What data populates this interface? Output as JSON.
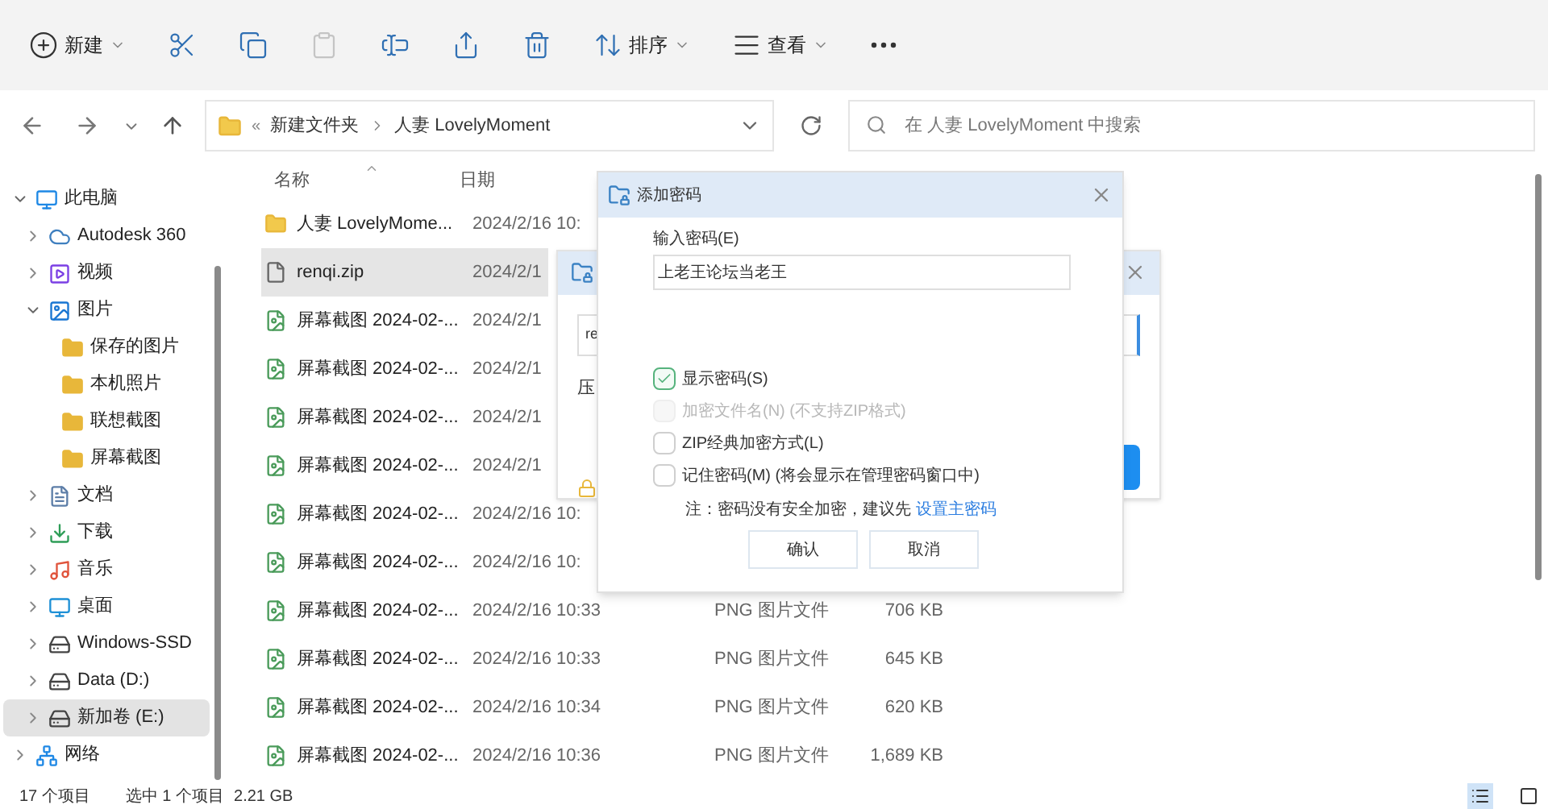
{
  "toolbar": {
    "items": [
      {
        "kind": "new",
        "label": "新建",
        "dropdown": true,
        "disabled": false
      },
      {
        "kind": "cut",
        "dropdown": false,
        "disabled": false
      },
      {
        "kind": "copy",
        "dropdown": false,
        "disabled": false
      },
      {
        "kind": "paste",
        "dropdown": false,
        "disabled": true
      },
      {
        "kind": "rename",
        "dropdown": false,
        "disabled": false
      },
      {
        "kind": "share",
        "dropdown": false,
        "disabled": false
      },
      {
        "kind": "delete",
        "dropdown": false,
        "disabled": false
      },
      {
        "kind": "sort",
        "label": "排序",
        "dropdown": true,
        "disabled": false
      },
      {
        "kind": "view",
        "label": "查看",
        "dropdown": true,
        "disabled": false
      },
      {
        "kind": "more",
        "dropdown": false,
        "disabled": false
      }
    ]
  },
  "address": {
    "overflow": "«",
    "segments": [
      "新建文件夹",
      "人妻 LovelyMoment"
    ]
  },
  "search": {
    "placeholder": "在 人妻 LovelyMoment 中搜索"
  },
  "sidebar": {
    "items": [
      {
        "kind": "pc",
        "label": "此电脑",
        "expanded": true,
        "selected": false,
        "children": [
          {
            "kind": "cloud",
            "label": "Autodesk 360",
            "expanded": false,
            "selected": false
          },
          {
            "kind": "video",
            "label": "视频",
            "expanded": false,
            "selected": false
          },
          {
            "kind": "picture",
            "label": "图片",
            "expanded": true,
            "selected": false,
            "children": [
              {
                "kind": "folder",
                "label": "保存的图片",
                "selected": false
              },
              {
                "kind": "folder",
                "label": "本机照片",
                "selected": false
              },
              {
                "kind": "folder",
                "label": "联想截图",
                "selected": false
              },
              {
                "kind": "folder",
                "label": "屏幕截图",
                "selected": false
              }
            ]
          },
          {
            "kind": "doc",
            "label": "文档",
            "expanded": false,
            "selected": false
          },
          {
            "kind": "download",
            "label": "下载",
            "expanded": false,
            "selected": false
          },
          {
            "kind": "music",
            "label": "音乐",
            "expanded": false,
            "selected": false
          },
          {
            "kind": "desktop",
            "label": "桌面",
            "expanded": false,
            "selected": false
          },
          {
            "kind": "drive",
            "label": "Windows-SSD",
            "expanded": false,
            "selected": false
          },
          {
            "kind": "drive",
            "label": "Data (D:)",
            "expanded": false,
            "selected": false
          },
          {
            "kind": "drive",
            "label": "新加卷 (E:)",
            "expanded": false,
            "selected": true
          }
        ]
      },
      {
        "kind": "network",
        "label": "网络",
        "expanded": false,
        "selected": false
      }
    ]
  },
  "file_list": {
    "columns": [
      "名称",
      "日期"
    ],
    "rows": [
      {
        "kind": "folder",
        "name": "人妻 LovelyMome...",
        "date": "2024/2/16 10:",
        "selected": false
      },
      {
        "kind": "file",
        "name": "renqi.zip",
        "date": "2024/2/1",
        "selected": true
      },
      {
        "kind": "image",
        "name": "屏幕截图 2024-02-...",
        "date": "2024/2/1",
        "selected": false
      },
      {
        "kind": "image",
        "name": "屏幕截图 2024-02-...",
        "date": "2024/2/1",
        "selected": false
      },
      {
        "kind": "image",
        "name": "屏幕截图 2024-02-...",
        "date": "2024/2/1",
        "selected": false
      },
      {
        "kind": "image",
        "name": "屏幕截图 2024-02-...",
        "date": "2024/2/1",
        "selected": false
      },
      {
        "kind": "image",
        "name": "屏幕截图 2024-02-...",
        "date": "2024/2/16 10:",
        "selected": false
      },
      {
        "kind": "image",
        "name": "屏幕截图 2024-02-...",
        "date": "2024/2/16 10:",
        "selected": false
      },
      {
        "kind": "image",
        "name": "屏幕截图 2024-02-...",
        "date": "2024/2/16 10:33",
        "type": "PNG 图片文件",
        "size": "706 KB",
        "selected": false
      },
      {
        "kind": "image",
        "name": "屏幕截图 2024-02-...",
        "date": "2024/2/16 10:33",
        "type": "PNG 图片文件",
        "size": "645 KB",
        "selected": false
      },
      {
        "kind": "image",
        "name": "屏幕截图 2024-02-...",
        "date": "2024/2/16 10:34",
        "type": "PNG 图片文件",
        "size": "620 KB",
        "selected": false
      },
      {
        "kind": "image",
        "name": "屏幕截图 2024-02-...",
        "date": "2024/2/16 10:36",
        "type": "PNG 图片文件",
        "size": "1,689 KB",
        "selected": false
      }
    ]
  },
  "back_dialog": {
    "field_value": "re",
    "label": "压"
  },
  "password_dialog": {
    "title": "添加密码",
    "field_label": "输入密码(E)",
    "field_value": "上老王论坛当老王",
    "options": [
      {
        "label": "显示密码(S)",
        "checked": true,
        "disabled": false
      },
      {
        "label": "加密文件名(N) (不支持ZIP格式)",
        "checked": false,
        "disabled": true
      },
      {
        "label": "ZIP经典加密方式(L)",
        "checked": false,
        "disabled": false
      },
      {
        "label": "记住密码(M) (将会显示在管理密码窗口中)",
        "checked": false,
        "disabled": false
      }
    ],
    "note": "注：密码没有安全加密，建议先",
    "note_link": "设置主密码",
    "buttons": [
      "确认",
      "取消"
    ]
  },
  "status_bar": {
    "count": "17 个项目",
    "selection": "选中 1 个项目",
    "size": "2.21 GB",
    "views": [
      {
        "kind": "details",
        "selected": true
      },
      {
        "kind": "tiles",
        "selected": false
      }
    ]
  }
}
